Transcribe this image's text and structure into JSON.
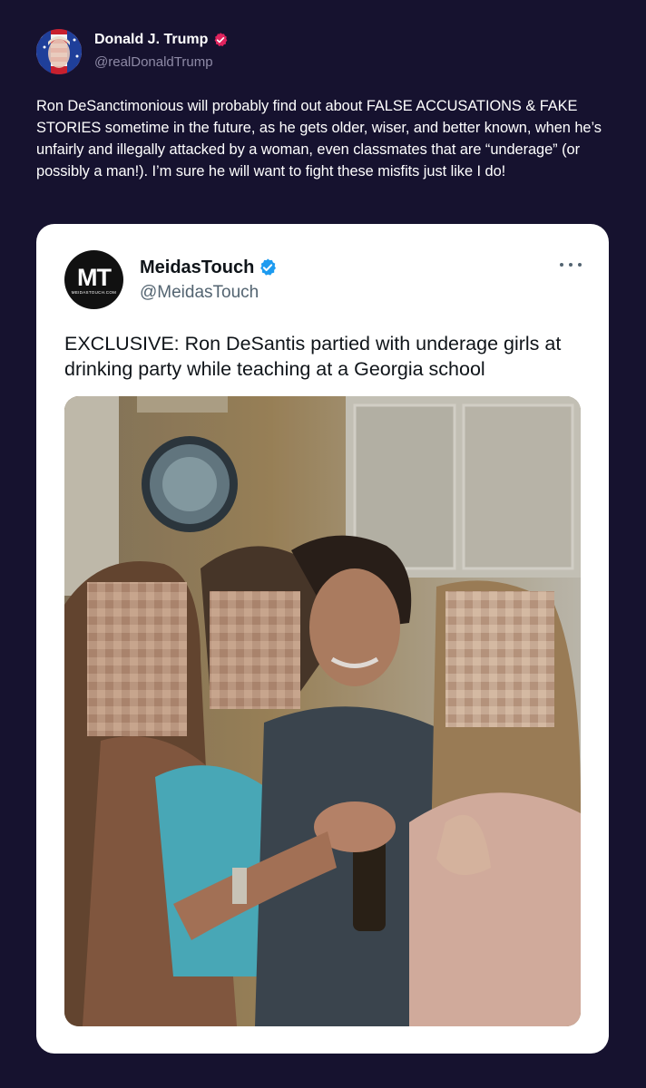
{
  "post": {
    "author": {
      "display_name": "Donald J. Trump",
      "handle": "@realDonaldTrump",
      "avatar_icon": "flag-portrait-avatar",
      "verified_icon": "verified-badge-icon",
      "verified_color": "#e0245e"
    },
    "text": "Ron DeSanctimonious will probably find out about FALSE ACCUSATIONS & FAKE STORIES sometime in the future, as he gets older, wiser, and better known, when he’s unfairly and illegally attacked by a woman, even classmates that are “underage” (or possibly a man!). I’m sure he will want to fight these misfits just like I do!"
  },
  "quoted": {
    "author": {
      "display_name": "MeidasTouch",
      "handle": "@MeidasTouch",
      "logo_letters": "MT",
      "logo_subtext": "MEIDASTOUCH.COM",
      "verified_icon": "verified-badge-icon",
      "verified_color": "#1d9bf0"
    },
    "more_icon": "more-options-icon",
    "text": "EXCLUSIVE: Ron DeSantis partied with underage girls at drinking party while teaching at a Georgia school",
    "media": {
      "type": "photo",
      "description_icon": "group-photo"
    }
  },
  "colors": {
    "background": "#16122f",
    "card": "#ffffff",
    "muted": "#8e8aa6"
  }
}
